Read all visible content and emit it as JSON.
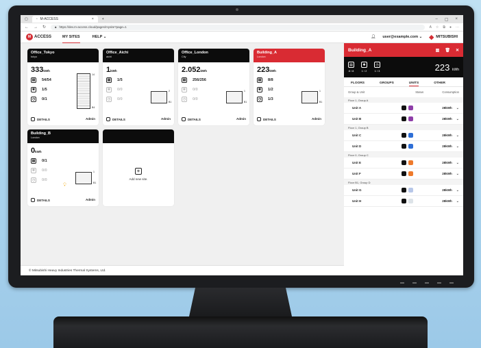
{
  "browser": {
    "tab_title": "M-ACCESS",
    "url": "https://dev.m-access.cloud/pages/mysite?page=1"
  },
  "app": {
    "logo_text": "ACCESS",
    "nav": [
      {
        "label": "MY SITES"
      },
      {
        "label": "HELP"
      }
    ],
    "user": "user@example.com",
    "brand": "MITSUBISHI"
  },
  "sites": [
    {
      "name": "Office_Tokyo",
      "location": "tokyo",
      "energy": "333",
      "unit": "kWh",
      "units": "54/54",
      "fans": "1/5",
      "alarms": "0/1",
      "floor_top": "14",
      "floor_bottom": "B4",
      "role": "Admin",
      "header": "#0c0c0c"
    },
    {
      "name": "Office_Aichi",
      "location": "aichi",
      "energy": "1",
      "unit": "kWh",
      "units": "1/5",
      "fans": "0/0",
      "alarms": "0/0",
      "floor_top": "2",
      "floor_bottom": "B1",
      "role": "Admin",
      "header": "#0c0c0c"
    },
    {
      "name": "Office_London",
      "location": "City",
      "energy": "2.052",
      "unit": "kWh",
      "units": "256/256",
      "fans": "0/0",
      "alarms": "0/0",
      "floor_top": "1",
      "floor_bottom": "B1",
      "role": "Admin",
      "header": "#0c0c0c"
    },
    {
      "name": "Building_A",
      "location": "London",
      "energy": "223",
      "unit": "kWh",
      "units": "8/8",
      "fans": "1/2",
      "alarms": "1/3",
      "floor_top": "1",
      "floor_bottom": "B1",
      "role": "Admin",
      "header": "#d92b33"
    },
    {
      "name": "Building_B",
      "location": "London",
      "energy": "0",
      "unit": "kWh",
      "units": "0/1",
      "fans": "0/0",
      "alarms": "0/0",
      "floor_top": "1",
      "floor_bottom": "B1",
      "role": "Admin",
      "header": "#0c0c0c"
    }
  ],
  "labels": {
    "details": "DETAILS",
    "add_site": "Add new site."
  },
  "footer": "© Mitsubishi Heavy Industries Thermal Systems, Ltd.",
  "panel": {
    "title": "Building_A",
    "units": "8 / 8",
    "fans": "1 / 2",
    "alarms": "1 / 3",
    "energy": "223",
    "energy_unit": "kWh",
    "tabs": [
      "FLOORS",
      "GROUPS",
      "UNITS",
      "OTHER"
    ],
    "columns": [
      "Group & Unit",
      "Status",
      "Consumption"
    ],
    "groups": [
      {
        "name": "Floor 1, Group A",
        "units": [
          {
            "name": "Unit A",
            "color": "#8e3ea8",
            "cons": "28kWh"
          },
          {
            "name": "Unit B",
            "color": "#8e3ea8",
            "cons": "28kWh"
          }
        ]
      },
      {
        "name": "Floor 1, Group B",
        "units": [
          {
            "name": "Unit C",
            "color": "#2f6fd6",
            "cons": "28kWh"
          },
          {
            "name": "Unit D",
            "color": "#2f6fd6",
            "cons": "28kWh"
          }
        ]
      },
      {
        "name": "Floor 0, Group C",
        "units": [
          {
            "name": "Unit E",
            "color": "#ee7a2c",
            "cons": "28kWh"
          },
          {
            "name": "Unit F",
            "color": "#ee7a2c",
            "cons": "28kWh"
          }
        ]
      },
      {
        "name": "Floor B1, Group D",
        "units": [
          {
            "name": "Unit G",
            "color": "#b7c7e8",
            "cons": "28kWh"
          },
          {
            "name": "Unit H",
            "color": "#dde3e8",
            "cons": "28kWh"
          }
        ]
      }
    ]
  }
}
